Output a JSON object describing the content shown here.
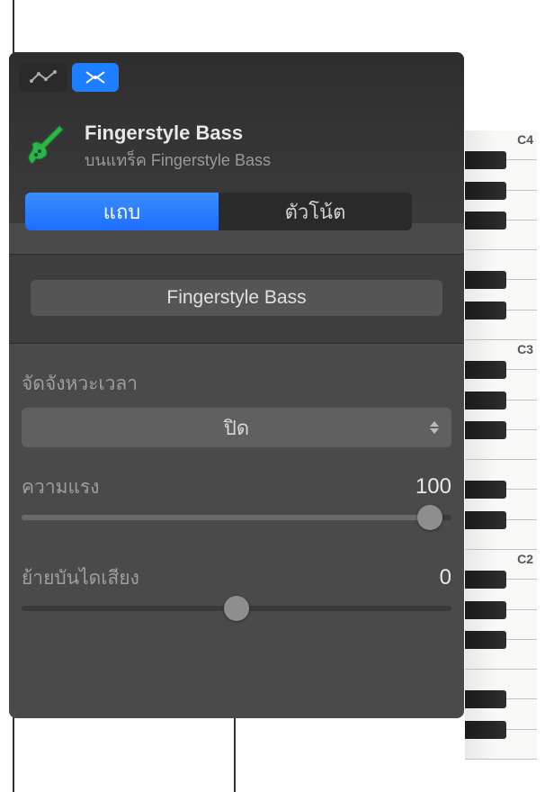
{
  "header": {
    "instrument_title": "Fingerstyle Bass",
    "instrument_subtitle": "บนแทร็ค Fingerstyle Bass"
  },
  "tabs": {
    "region_label": "แถบ",
    "notes_label": "ตัวโน้ต"
  },
  "region": {
    "name": "Fingerstyle Bass"
  },
  "quantize": {
    "label": "จัดจังหวะเวลา",
    "value": "ปิด"
  },
  "velocity": {
    "label": "ความแรง",
    "value": "100",
    "percent": 95
  },
  "transpose": {
    "label": "ย้ายบันไดเสียง",
    "value": "0",
    "percent": 50
  },
  "keyboard": {
    "labels": [
      "C4",
      "C3",
      "C2"
    ]
  }
}
